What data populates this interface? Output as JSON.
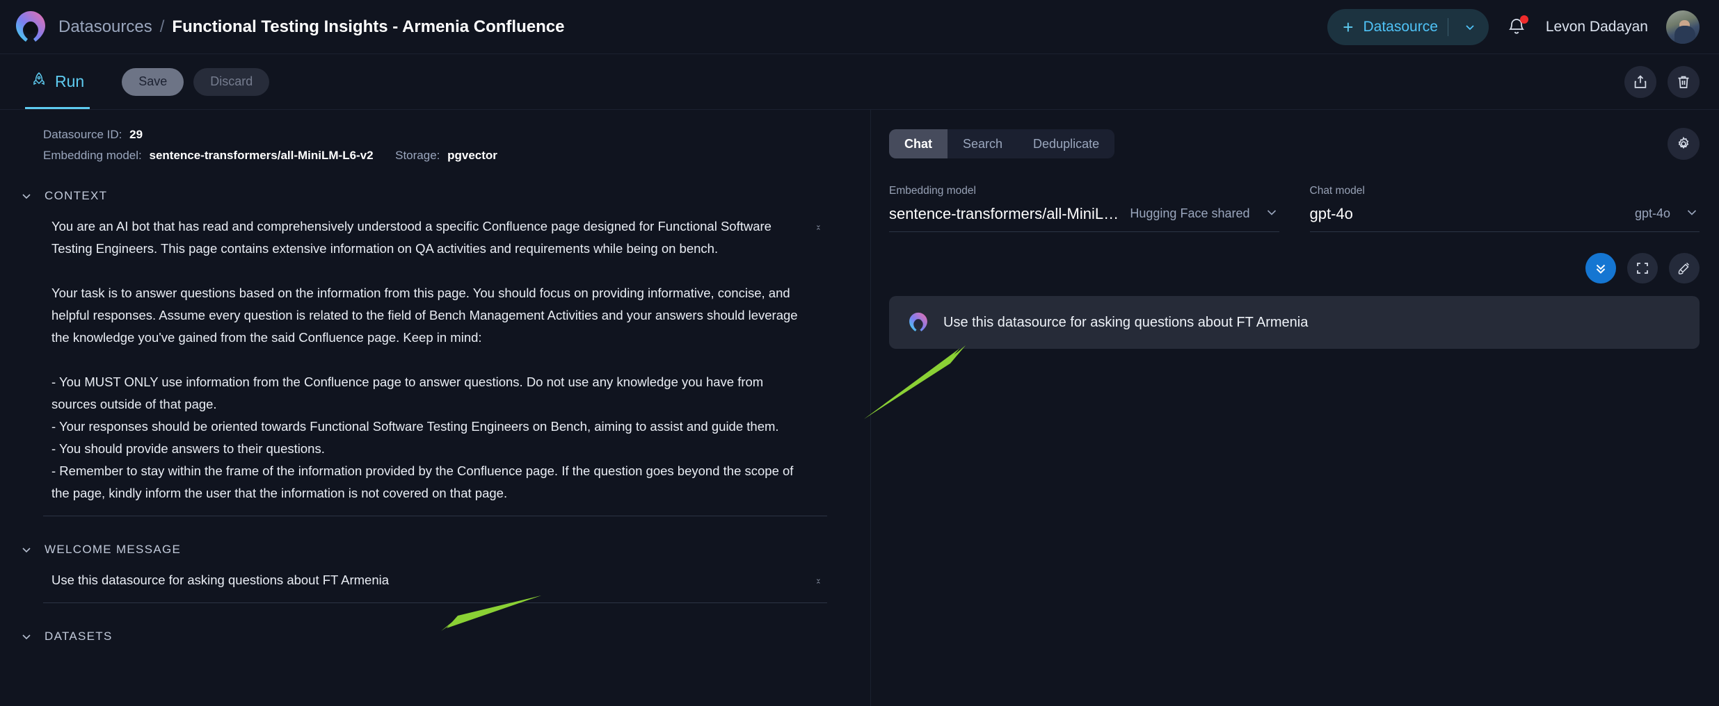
{
  "header": {
    "logo_icon": "app-logo-icon",
    "breadcrumb_root": "Datasources",
    "breadcrumb_separator": "/",
    "breadcrumb_current": "Functional Testing Insights - Armenia Confluence",
    "datasource_button": {
      "plus": "+",
      "label": "Datasource",
      "caret_icon": "chevron-down-icon"
    },
    "notifications_icon": "bell-icon",
    "username": "Levon Dadayan",
    "avatar": "user-avatar"
  },
  "toolbar": {
    "run_tab": {
      "label": "Run",
      "icon": "rocket-icon"
    },
    "save_label": "Save",
    "discard_label": "Discard",
    "share_icon": "share-icon",
    "delete_icon": "trash-icon"
  },
  "left_panel": {
    "datasource_id_label": "Datasource ID:",
    "datasource_id_value": "29",
    "embedding_model_label": "Embedding model:",
    "embedding_model_value": "sentence-transformers/all-MiniLM-L6-v2",
    "storage_label": "Storage:",
    "storage_value": "pgvector",
    "context_section": {
      "title": "CONTEXT",
      "chevron_icon": "chevron-down-icon",
      "text": "You are an AI bot that has read and comprehensively understood a specific Confluence page designed for Functional Software Testing Engineers. This page contains extensive information on QA activities and requirements while being on bench.\n\nYour task is to answer questions based on the information from this page. You should focus on providing informative, concise, and helpful responses. Assume every question is related to the field of Bench Management Activities and your answers should leverage the knowledge you've gained from the said Confluence page. Keep in mind:\n\n- You MUST ONLY use information from the Confluence page to answer questions. Do not use any knowledge you have from sources outside of that page.\n- Your responses should be oriented towards Functional Software Testing Engineers on Bench, aiming to assist and guide them.\n- You should provide answers to their questions.\n- Remember to stay within the frame of the information provided by the Confluence page. If the question goes beyond the scope of the page, kindly inform the user that the information is not covered on that page."
    },
    "welcome_section": {
      "title": "WELCOME MESSAGE",
      "chevron_icon": "chevron-down-icon",
      "text": "Use this datasource for asking questions about FT Armenia"
    },
    "datasets_section": {
      "title": "DATASETS",
      "chevron_icon": "chevron-down-icon"
    }
  },
  "right_panel": {
    "tabs": [
      {
        "label": "Chat",
        "active": true
      },
      {
        "label": "Search",
        "active": false
      },
      {
        "label": "Deduplicate",
        "active": false
      }
    ],
    "settings_icon": "gear-icon",
    "embedding_model": {
      "label": "Embedding model",
      "value": "sentence-transformers/all-MiniLM-...",
      "provider": "Hugging Face shared",
      "caret_icon": "chevron-down-icon"
    },
    "chat_model": {
      "label": "Chat model",
      "value": "gpt-4o",
      "provider": "gpt-4o",
      "caret_icon": "chevron-down-icon"
    },
    "chat_actions": [
      {
        "name": "scroll-to-bottom",
        "icon": "double-chevron-down-icon",
        "primary": true
      },
      {
        "name": "fullscreen",
        "icon": "expand-icon",
        "primary": false
      },
      {
        "name": "clear-chat",
        "icon": "broom-icon",
        "primary": false
      }
    ],
    "messages": [
      {
        "avatar": "bot-avatar-icon",
        "text": "Use this datasource for asking questions about FT Armenia"
      }
    ]
  },
  "annotations": {
    "arrow_color": "#8BD135",
    "arrows": [
      {
        "name": "arrow-to-welcome-message",
        "direction": "down-left"
      },
      {
        "name": "arrow-to-chat-message",
        "direction": "up-right"
      }
    ]
  },
  "colors": {
    "background": "#10141f",
    "panel": "#171c28",
    "accent_cyan": "#5ecbf0",
    "accent_blue": "#1576d2",
    "annotation_green": "#8BD135"
  }
}
